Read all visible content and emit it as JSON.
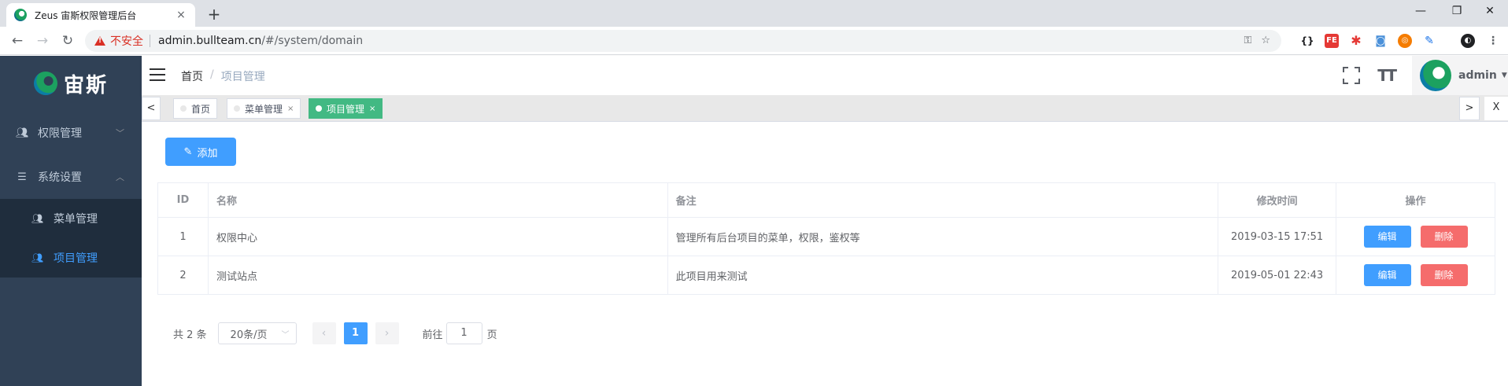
{
  "browser": {
    "tab_title": "Zeus 宙斯权限管理后台",
    "close_tab": "×",
    "new_tab": "+",
    "insecure_label": "不安全",
    "url_host": "admin.bullteam.cn",
    "url_path": "/#/system/domain",
    "window": {
      "minimize": "—",
      "maximize": "❐",
      "close": "✕"
    }
  },
  "sidebar": {
    "logo_text": "宙斯",
    "menu": [
      {
        "label": "权限管理",
        "icon": "user-icon",
        "expanded": false
      },
      {
        "label": "系统设置",
        "icon": "list-icon",
        "expanded": true
      }
    ],
    "submenu": [
      {
        "label": "菜单管理",
        "icon": "user-icon",
        "active": false
      },
      {
        "label": "项目管理",
        "icon": "user-icon",
        "active": true
      }
    ]
  },
  "navbar": {
    "breadcrumb": {
      "home": "首页",
      "separator": "/",
      "current": "项目管理"
    },
    "size_icon": "TT",
    "username": "admin"
  },
  "tags": {
    "prev": "<",
    "next": ">",
    "close_all": "X",
    "items": [
      {
        "label": "首页",
        "active": false,
        "closable": false
      },
      {
        "label": "菜单管理",
        "active": false,
        "closable": true,
        "close": "×"
      },
      {
        "label": "项目管理",
        "active": true,
        "closable": true,
        "close": "×"
      }
    ]
  },
  "main": {
    "add_button": "添加",
    "table": {
      "columns": [
        "ID",
        "名称",
        "备注",
        "修改时间",
        "操作"
      ],
      "rows": [
        {
          "id": "1",
          "name": "权限中心",
          "remark": "管理所有后台项目的菜单，权限，鉴权等",
          "modified": "2019-03-15 17:51",
          "edit": "编辑",
          "delete": "删除"
        },
        {
          "id": "2",
          "name": "测试站点",
          "remark": "此项目用来测试",
          "modified": "2019-05-01 22:43",
          "edit": "编辑",
          "delete": "删除"
        }
      ]
    },
    "pagination": {
      "total_text": "共 2 条",
      "page_size": "20条/页",
      "prev": "‹",
      "current_page": "1",
      "next": "›",
      "goto_label": "前往",
      "goto_value": "1",
      "page_unit": "页"
    }
  },
  "colors": {
    "sidebar_bg": "#304156",
    "primary": "#409eff",
    "danger": "#f56c6c",
    "tag_active": "#42b983"
  }
}
